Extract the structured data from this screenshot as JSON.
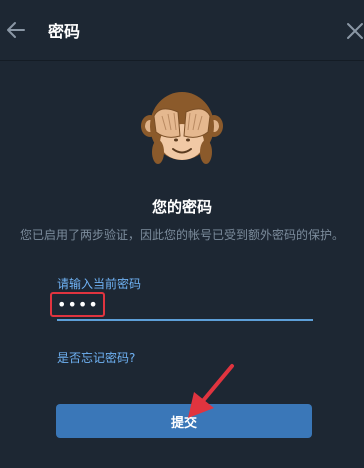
{
  "header": {
    "title": "密码",
    "back_icon": "arrow-left-icon",
    "close_icon": "close-icon"
  },
  "main": {
    "illustration": "see-no-evil-monkey",
    "heading": "您的密码",
    "description": "您已启用了两步验证，因此您的帐号已受到额外密码的保护。"
  },
  "password_field": {
    "label": "请输入当前密码",
    "value": "••••"
  },
  "forgot_link": "是否忘记密码?",
  "submit_label": "提交",
  "colors": {
    "background": "#1d2733",
    "accent": "#6fb2f4",
    "button": "#3a77b8",
    "annotation": "#e0343f"
  }
}
